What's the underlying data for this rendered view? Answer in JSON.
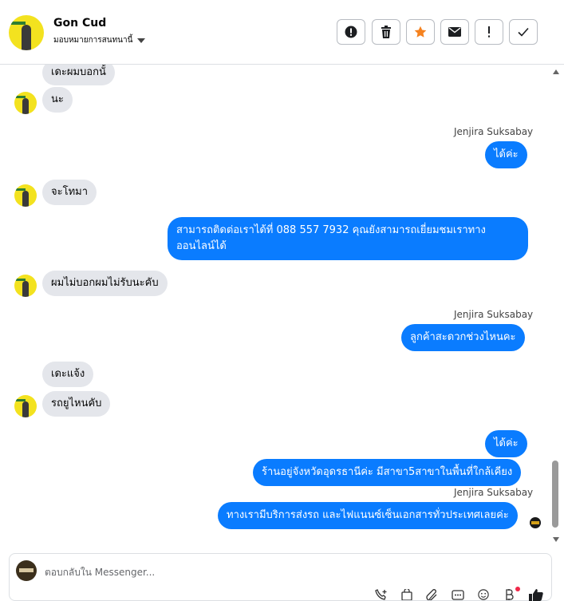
{
  "header": {
    "contact_name": "Gon Cud",
    "assign_label": "มอบหมายการสนทนานี้",
    "buttons": [
      {
        "name": "report-button",
        "icon": "exclamation-circle-icon"
      },
      {
        "name": "delete-button",
        "icon": "trash-icon"
      },
      {
        "name": "star-button",
        "icon": "star-icon",
        "color": "#f5821f"
      },
      {
        "name": "mark-unread-button",
        "icon": "envelope-icon"
      },
      {
        "name": "follow-up-button",
        "icon": "exclamation-icon"
      },
      {
        "name": "done-button",
        "icon": "check-icon"
      }
    ]
  },
  "messages": [
    {
      "dir": "in",
      "text": "เดะผมบอกนั้"
    },
    {
      "dir": "in",
      "text": "นะ"
    },
    {
      "dir": "out",
      "sender": "Jenjira Suksabay",
      "text": "ได้ค่ะ"
    },
    {
      "dir": "in",
      "text": "จะโทมา"
    },
    {
      "dir": "out",
      "text_line1": "สามารถติดต่อเราได้ที่ 088 557 7932 คุณยังสามารถเยี่ยมชมเราทาง",
      "text_line2": "ออนไลน์ได้"
    },
    {
      "dir": "in",
      "text": "ผมไม่บอกผมไม่รับนะคับ"
    },
    {
      "dir": "out",
      "sender": "Jenjira Suksabay",
      "text": "ลูกค้าสะดวกช่วงไหนคะ"
    },
    {
      "dir": "in",
      "text": "เดะแจ้ง"
    },
    {
      "dir": "in",
      "text": "รถยูไหนคับ"
    },
    {
      "dir": "out",
      "text": "ได้ค่ะ"
    },
    {
      "dir": "out",
      "text": "ร้านอยู่จังหวัดอุดรธานีค่ะ มีสาขา5สาขาในพื้นที่ใกล้เคียง"
    },
    {
      "dir": "out",
      "sender": "Jenjira Suksabay",
      "text": "ทางเรามีบริการส่งรถ และไฟแนนซ์เซ็นเอกสารทั่วประเทศเลยค่ะ"
    }
  ],
  "composer": {
    "placeholder": "ตอบกลับใน Messenger...",
    "tools": [
      "add-contact-icon",
      "shopping-bag-icon",
      "paperclip-icon",
      "saved-reply-icon",
      "emoji-icon",
      "currency-icon",
      "thumbs-up-icon"
    ]
  },
  "colors": {
    "outgoing": "#0a7cff",
    "incoming": "#e4e6eb",
    "star": "#f5821f"
  }
}
